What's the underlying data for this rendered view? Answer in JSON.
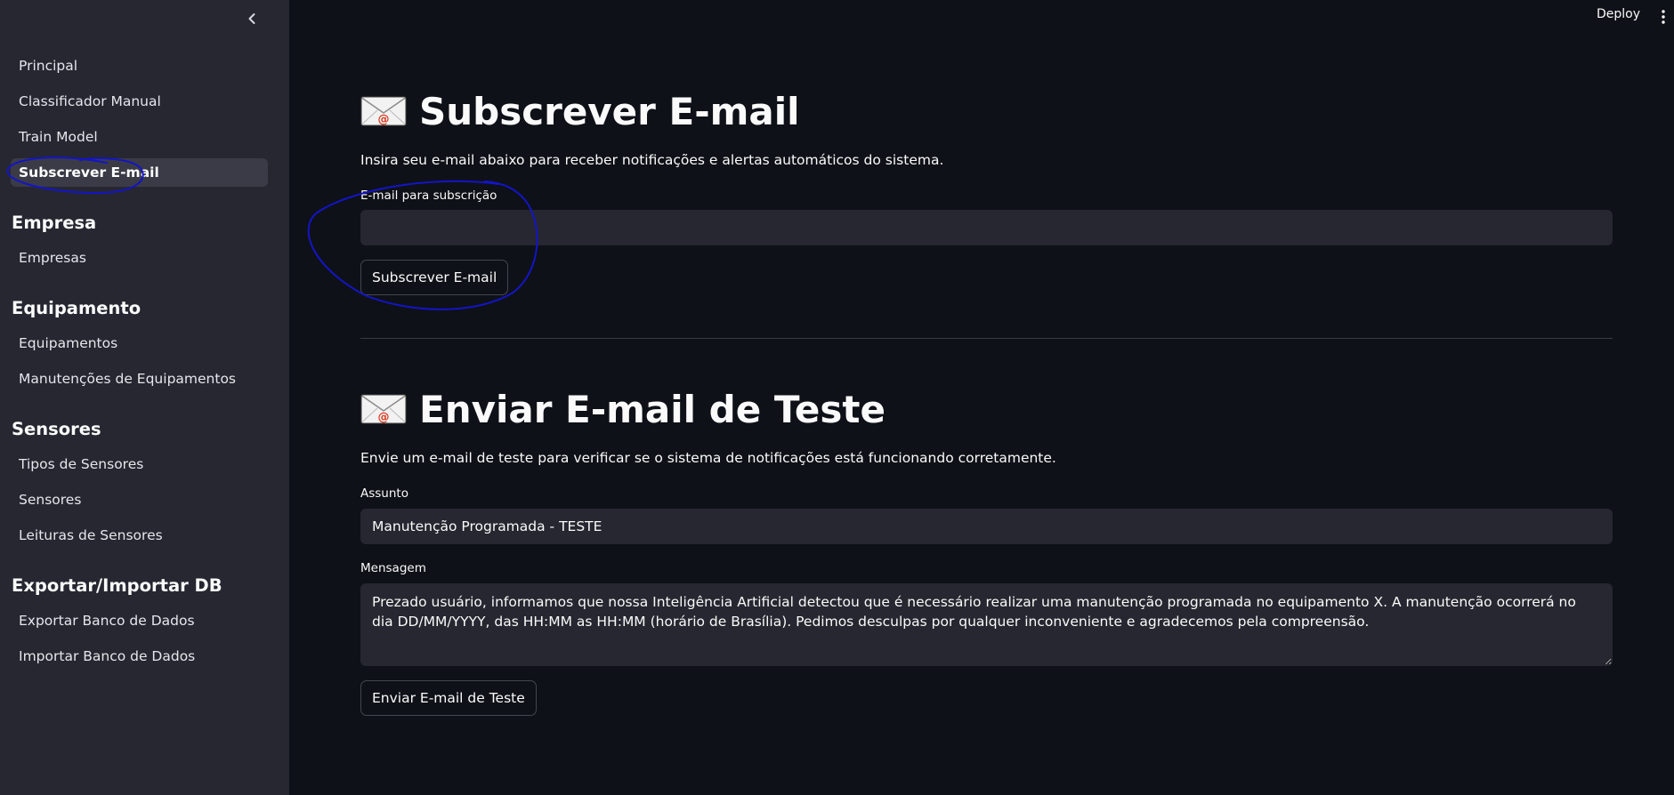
{
  "header": {
    "deploy_label": "Deploy",
    "menu_icon": "kebab-menu-icon"
  },
  "sidebar": {
    "collapse_icon": "chevron-left-icon",
    "items": [
      {
        "label": "Principal",
        "active": false
      },
      {
        "label": "Classificador Manual",
        "active": false
      },
      {
        "label": "Train Model",
        "active": false
      },
      {
        "label": "Subscrever E-mail",
        "active": true
      }
    ],
    "sections": [
      {
        "title": "Empresa",
        "items": [
          {
            "label": "Empresas"
          }
        ]
      },
      {
        "title": "Equipamento",
        "items": [
          {
            "label": "Equipamentos"
          },
          {
            "label": "Manutenções de Equipamentos"
          }
        ]
      },
      {
        "title": "Sensores",
        "items": [
          {
            "label": "Tipos de Sensores"
          },
          {
            "label": "Sensores"
          },
          {
            "label": "Leituras de Sensores"
          }
        ]
      },
      {
        "title": "Exportar/Importar DB",
        "items": [
          {
            "label": "Exportar Banco de Dados"
          },
          {
            "label": "Importar Banco de Dados"
          }
        ]
      }
    ]
  },
  "subscribe": {
    "icon": "envelope-icon",
    "title": "Subscrever E-mail",
    "description": "Insira seu e-mail abaixo para receber notificações e alertas automáticos do sistema.",
    "email_label": "E-mail para subscrição",
    "email_value": "",
    "button_label": "Subscrever E-mail"
  },
  "test_email": {
    "icon": "envelope-icon",
    "title": "Enviar E-mail de Teste",
    "description": "Envie um e-mail de teste para verificar se o sistema de notificações está funcionando corretamente.",
    "subject_label": "Assunto",
    "subject_value": "Manutenção Programada - TESTE",
    "message_label": "Mensagem",
    "message_value": "Prezado usuário, informamos que nossa Inteligência Artificial detectou que é necessário realizar uma manutenção programada no equipamento X. A manutenção ocorrerá no dia DD/MM/YYYY, das HH:MM as HH:MM (horário de Brasília). Pedimos desculpas por qualquer inconveniente e agradecemos pela compreensão.",
    "button_label": "Enviar E-mail de Teste"
  },
  "colors": {
    "background": "#0e1117",
    "sidebar": "#262730",
    "input": "#262730",
    "annotation_ink": "#1010c8"
  }
}
